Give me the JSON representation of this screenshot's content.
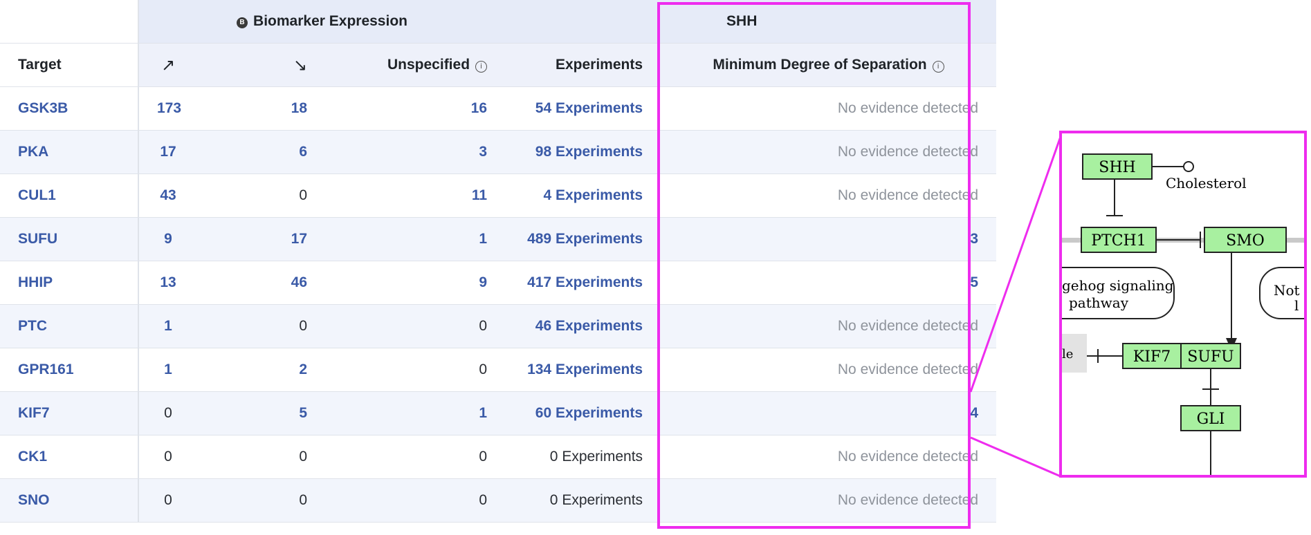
{
  "header": {
    "biomarker_badge": "B",
    "biomarker_title": "Biomarker Expression",
    "shh_title": "SHH",
    "col_target": "Target",
    "col_up": "↗",
    "col_down": "↘",
    "col_unspecified": "Unspecified",
    "col_experiments": "Experiments",
    "col_min_sep": "Minimum Degree of Separation",
    "info_glyph": "i"
  },
  "rows": [
    {
      "target": "GSK3B",
      "up": "173",
      "down": "18",
      "unspecified": "16",
      "exp_count": "54",
      "exp_label": "Experiments",
      "separation": "No evidence detected"
    },
    {
      "target": "PKA",
      "up": "17",
      "down": "6",
      "unspecified": "3",
      "exp_count": "98",
      "exp_label": "Experiments",
      "separation": "No evidence detected"
    },
    {
      "target": "CUL1",
      "up": "43",
      "down": "0",
      "unspecified": "11",
      "exp_count": "4",
      "exp_label": "Experiments",
      "separation": "No evidence detected"
    },
    {
      "target": "SUFU",
      "up": "9",
      "down": "17",
      "unspecified": "1",
      "exp_count": "489",
      "exp_label": "Experiments",
      "separation": "3"
    },
    {
      "target": "HHIP",
      "up": "13",
      "down": "46",
      "unspecified": "9",
      "exp_count": "417",
      "exp_label": "Experiments",
      "separation": "5"
    },
    {
      "target": "PTC",
      "up": "1",
      "down": "0",
      "unspecified": "0",
      "exp_count": "46",
      "exp_label": "Experiments",
      "separation": "No evidence detected"
    },
    {
      "target": "GPR161",
      "up": "1",
      "down": "2",
      "unspecified": "0",
      "exp_count": "134",
      "exp_label": "Experiments",
      "separation": "No evidence detected"
    },
    {
      "target": "KIF7",
      "up": "0",
      "down": "5",
      "unspecified": "1",
      "exp_count": "60",
      "exp_label": "Experiments",
      "separation": "4"
    },
    {
      "target": "CK1",
      "up": "0",
      "down": "0",
      "unspecified": "0",
      "exp_count": "0",
      "exp_label": "Experiments",
      "separation": "No evidence detected"
    },
    {
      "target": "SNO",
      "up": "0",
      "down": "0",
      "unspecified": "0",
      "exp_count": "0",
      "exp_label": "Experiments",
      "separation": "No evidence detected"
    }
  ],
  "pathway": {
    "shh": "SHH",
    "cholesterol": "Cholesterol",
    "ptch1": "PTCH1",
    "smo": "SMO",
    "hedgehog_line1": "gehog signaling",
    "hedgehog_line2": "pathway",
    "notch_line1": "Not",
    "notch_line2": "l",
    "partial_left": "le",
    "kif7": "KIF7",
    "sufu": "SUFU",
    "gli": "GLI"
  },
  "colors": {
    "highlight": "#ee2cee",
    "link": "#3a5aa7",
    "gene_box": "#a8f0a0",
    "header_bg": "#e6ebf8"
  }
}
